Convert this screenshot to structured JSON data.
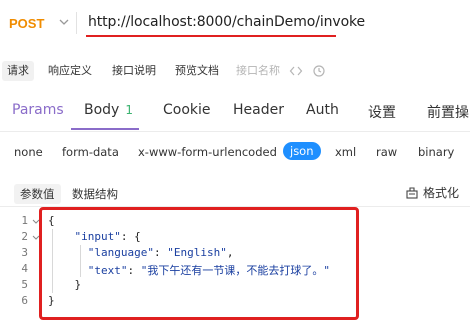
{
  "request": {
    "method": "POST",
    "url": "http://localhost:8000/chainDemo/invoke"
  },
  "tool_tabs": [
    {
      "label": "请求",
      "active": true
    },
    {
      "label": "响应定义"
    },
    {
      "label": "接口说明"
    },
    {
      "label": "预览文档"
    },
    {
      "label": "接口名称",
      "muted": true
    }
  ],
  "main_tabs": {
    "params": "Params",
    "body": "Body",
    "body_count": "1",
    "cookie": "Cookie",
    "header": "Header",
    "auth": "Auth",
    "settings": "设置",
    "pre": "前置操"
  },
  "body_types": [
    "none",
    "form-data",
    "x-www-form-urlencoded",
    "json",
    "xml",
    "raw",
    "binary"
  ],
  "body_type_selected": "json",
  "sub_tabs": {
    "values": "参数值",
    "structure": "数据结构",
    "format": "格式化"
  },
  "editor": {
    "line_numbers": [
      "1",
      "2",
      "3",
      "4",
      "5",
      "6"
    ],
    "lines": [
      {
        "indent": "",
        "text": "{"
      },
      {
        "indent": "    ",
        "key": "\"input\"",
        "rest": ": {"
      },
      {
        "indent": "      ",
        "key": "\"language\"",
        "rest": ": ",
        "value": "\"English\"",
        "tail": ","
      },
      {
        "indent": "      ",
        "key": "\"text\"",
        "rest": ": ",
        "value": "\"我下午还有一节课，不能去打球了。\"",
        "tail": ""
      },
      {
        "indent": "    ",
        "text": "}"
      },
      {
        "indent": "",
        "text": "}"
      }
    ]
  },
  "colors": {
    "method": "#f08c00",
    "accent": "#8a6cc9",
    "selected_pill": "#1e8fff",
    "badge": "#3cb371",
    "annotation": "#e02020"
  }
}
